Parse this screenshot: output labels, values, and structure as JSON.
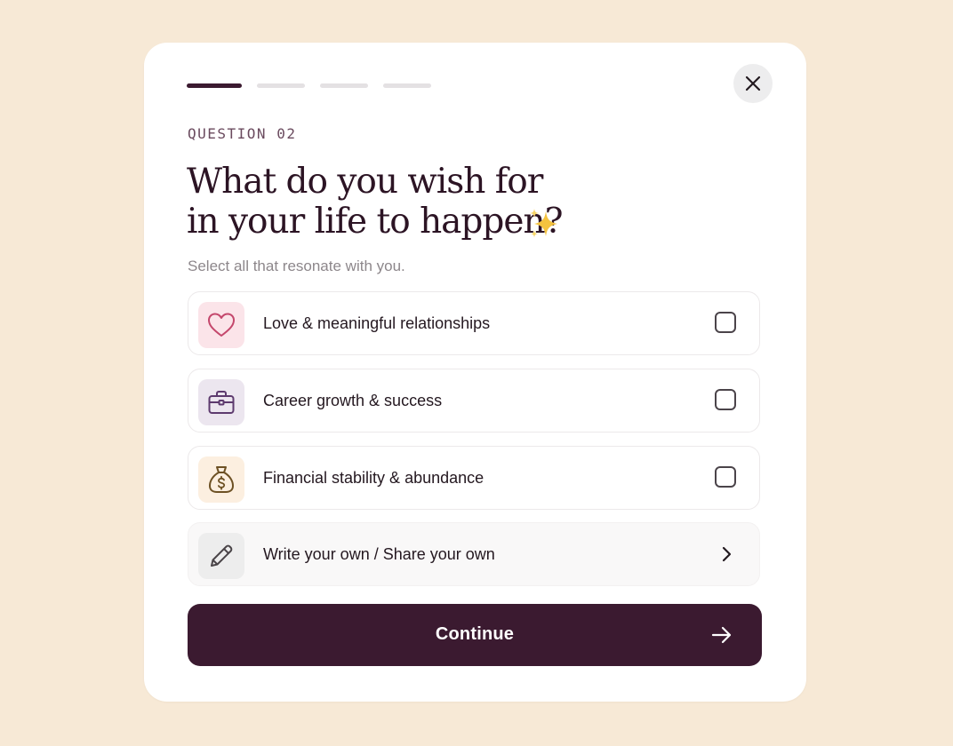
{
  "progress": {
    "total_steps": 4,
    "current_step": 1
  },
  "close_icon": "close-icon",
  "question": {
    "eyebrow": "QUESTION 02",
    "title_line1": "What do you wish for",
    "title_line2": "in your life to happen?",
    "title_emoji": "sparkles-icon",
    "subtitle": "Select all that resonate with you."
  },
  "options": [
    {
      "label": "Love & meaningful relationships",
      "icon": "heart-icon",
      "checked": false,
      "icon_bg": "#fbe4e9",
      "icon_color": "#c4476c"
    },
    {
      "label": "Career growth & success",
      "icon": "briefcase-icon",
      "checked": false,
      "icon_bg": "#ece6ef",
      "icon_color": "#5d3a6e"
    },
    {
      "label": "Financial stability & abundance",
      "icon": "money-bag-icon",
      "checked": false,
      "icon_bg": "#fcefe0",
      "icon_color": "#6d5124"
    }
  ],
  "write_own": {
    "label": "Write your own / Share your own",
    "icon": "pencil-icon"
  },
  "continue_button": {
    "label": "Continue",
    "icon": "arrow-right-icon"
  },
  "colors": {
    "background": "#f7e9d6",
    "primary": "#3b1a30",
    "card": "#ffffff"
  }
}
